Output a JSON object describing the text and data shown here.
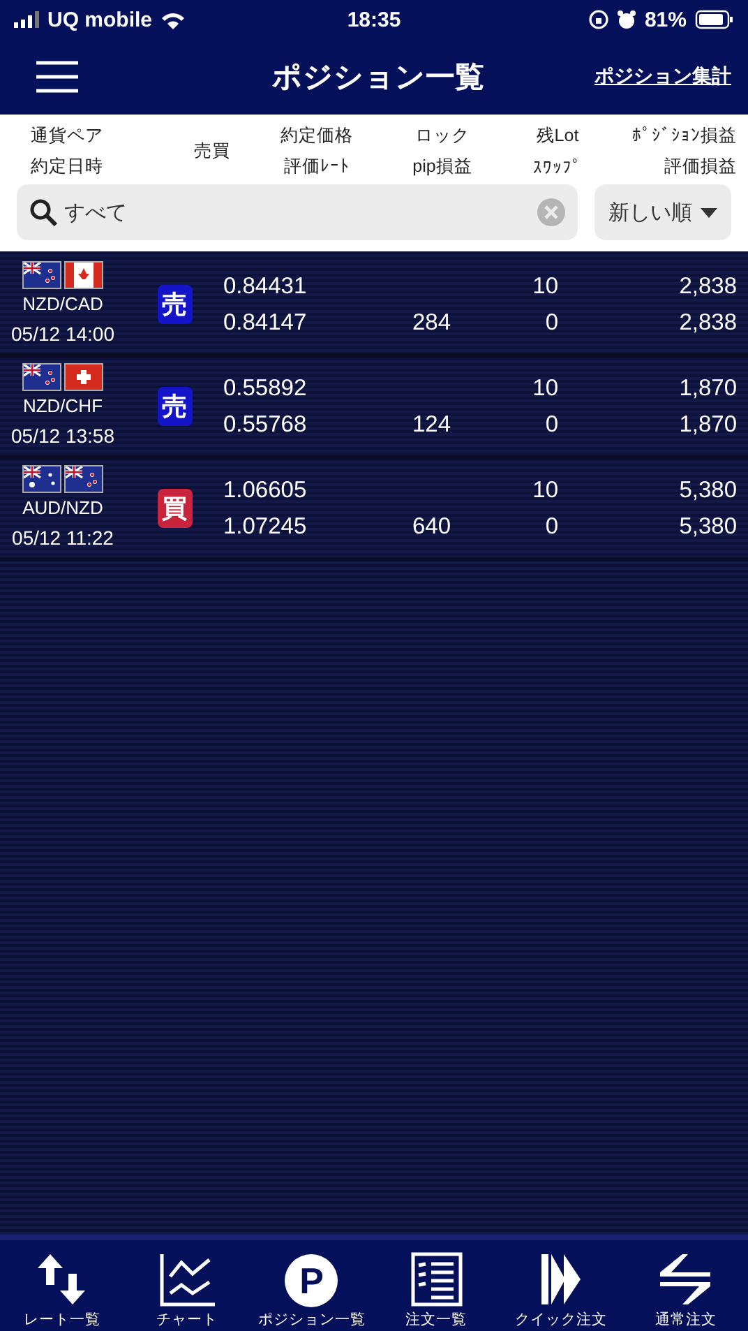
{
  "status_bar": {
    "carrier": "UQ mobile",
    "time": "18:35",
    "battery": "81%"
  },
  "header": {
    "title": "ポジション一覧",
    "link": "ポジション集計"
  },
  "columns": [
    {
      "top": "通貨ペア",
      "bottom": "約定日時"
    },
    {
      "top": "売買"
    },
    {
      "top": "約定価格",
      "bottom": "評価ﾚｰﾄ"
    },
    {
      "top": "ロック",
      "bottom": "pip損益"
    },
    {
      "top": "残Lot",
      "bottom": "ｽﾜｯﾌﾟ"
    },
    {
      "top": "ﾎﾟｼﾞｼｮﾝ損益",
      "bottom": "評価損益"
    }
  ],
  "search": {
    "value": "すべて"
  },
  "sort": {
    "value": "新しい順"
  },
  "positions": [
    {
      "pair": "NZD/CAD",
      "flags": [
        {
          "kind": "nz"
        },
        {
          "kind": "ca"
        }
      ],
      "time": "05/12 14:00",
      "side": {
        "label": "売",
        "color": "#1414c8"
      },
      "open_price": "0.84431",
      "rate": "0.84147",
      "pips": "284",
      "lot": "10",
      "swap": "0",
      "position_pnl": "2,838",
      "valuation_pnl": "2,838"
    },
    {
      "pair": "NZD/CHF",
      "flags": [
        {
          "kind": "nz"
        },
        {
          "kind": "ch"
        }
      ],
      "time": "05/12 13:58",
      "side": {
        "label": "売",
        "color": "#1414c8"
      },
      "open_price": "0.55892",
      "rate": "0.55768",
      "pips": "124",
      "lot": "10",
      "swap": "0",
      "position_pnl": "1,870",
      "valuation_pnl": "1,870"
    },
    {
      "pair": "AUD/NZD",
      "flags": [
        {
          "kind": "au"
        },
        {
          "kind": "nz"
        }
      ],
      "time": "05/12 11:22",
      "side": {
        "label": "買",
        "color": "#c8243c"
      },
      "open_price": "1.06605",
      "rate": "1.07245",
      "pips": "640",
      "lot": "10",
      "swap": "0",
      "position_pnl": "5,380",
      "valuation_pnl": "5,380"
    }
  ],
  "tabs": [
    {
      "kind": "rates",
      "label": "レート一覧"
    },
    {
      "kind": "chart",
      "label": "チャート"
    },
    {
      "kind": "position",
      "label": "ポジション一覧",
      "icon_text": "P"
    },
    {
      "kind": "orders",
      "label": "注文一覧"
    },
    {
      "kind": "quick",
      "label": "クイック注文"
    },
    {
      "kind": "normal",
      "label": "通常注文"
    }
  ]
}
